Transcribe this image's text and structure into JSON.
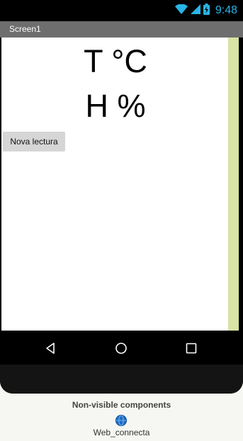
{
  "status_bar": {
    "time": "9:48",
    "icons": [
      "wifi-icon",
      "signal-icon",
      "battery-charging-icon"
    ],
    "time_color": "#2ab4e6"
  },
  "screen": {
    "title": "Screen1",
    "temperature_label": "T °C",
    "humidity_label": "H %",
    "read_button_label": "Nova lectura"
  },
  "navigation": {
    "icons": [
      "back-icon",
      "home-icon",
      "recent-apps-icon"
    ]
  },
  "non_visible": {
    "title": "Non-visible components",
    "components": [
      {
        "name": "Web_connecta",
        "icon": "web-globe-icon"
      }
    ]
  },
  "colors": {
    "title_bar": "#6e6e6e",
    "scroll_strip": "#d8e3a4",
    "button": "#d6d6d6"
  }
}
